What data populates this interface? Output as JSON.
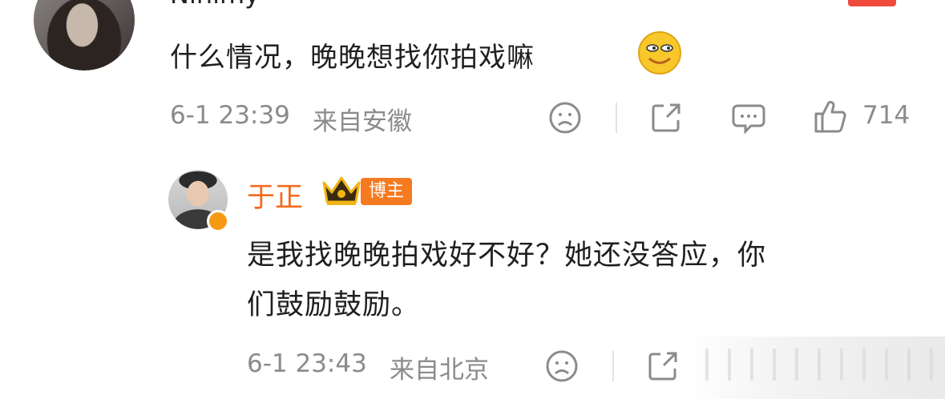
{
  "comment": {
    "username": "Ninimy",
    "text": "什么情况，晚晚想找你拍戏嘛",
    "timestamp": "6-1 23:39",
    "location": "来自安徽",
    "likes": "714"
  },
  "reply": {
    "username": "于正",
    "tag": "博主",
    "text_line1": "是我找晚晚拍戏好不好？她还没答应，你",
    "text_line2": "们鼓励鼓励。",
    "timestamp": "6-1 23:43",
    "location": "来自北京"
  },
  "icons": [
    "sad-face-icon",
    "share-icon",
    "comment-icon",
    "thumbs-up-icon",
    "crown-icon",
    "smile-emoji-icon",
    "verified-icon"
  ],
  "colors": {
    "username_reply": "#f26b1d",
    "tag_bg": "#f57a20",
    "meta": "#8b8b8b",
    "verified": "#f59a12"
  }
}
